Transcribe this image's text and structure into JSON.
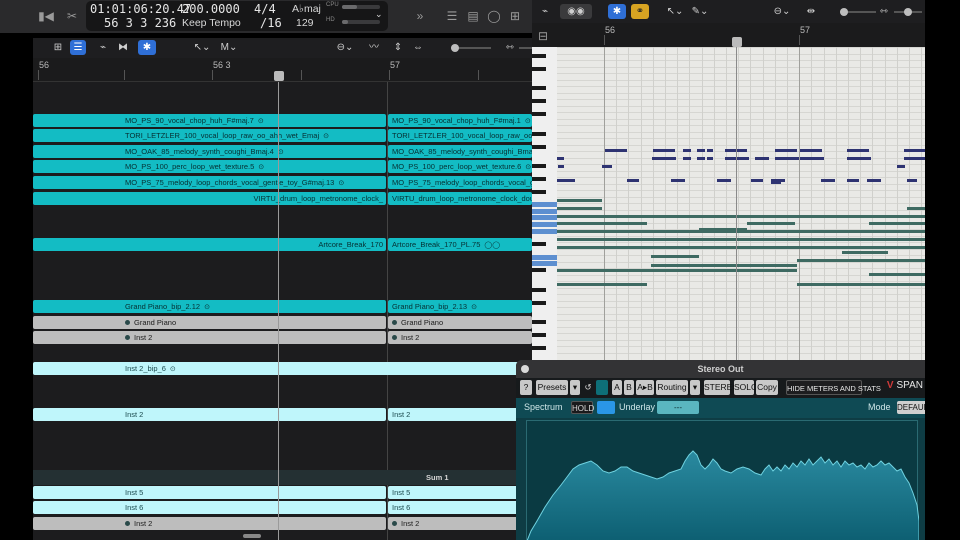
{
  "lcd": {
    "time": "01:01:06:20.47",
    "bars": "56  3  3  236",
    "tempo": "200.0000",
    "tempo_mode": "Keep Tempo",
    "signature": "4/4",
    "division": "/16",
    "key": "A♭maj",
    "midi_value": "129",
    "cpu_label": "CPU",
    "hd_label": "HD"
  },
  "ruler": {
    "bar56": "56",
    "bar56_3": "56 3",
    "bar57": "57"
  },
  "piano_ruler": {
    "bar56": "56",
    "bar57": "57"
  },
  "tracktoolbar": {
    "edit_menu": "M"
  },
  "regions": {
    "vocal_chop_a": "MO_PS_90_vocal_chop_huh_F#maj.7",
    "vocal_chop_b": "MO_PS_90_vocal_chop_huh_F#maj.1",
    "tori_a": "TORI_LETZLER_100_vocal_loop_raw_oo_ahh_wet_Emaj",
    "tori_b": "TORI_LETZLER_100_vocal_loop_raw_oo_ahh",
    "oak_a": "MO_OAK_85_melody_synth_coughi_Bmaj.4",
    "oak_b": "MO_OAK_85_melody_synth_coughi_Bmaj.5",
    "perc_a": "MO_PS_100_perc_loop_wet_texture.5",
    "perc_b": "MO_PS_100_perc_loop_wet_texture.6",
    "chords_a": "MO_PS_75_melody_loop_chords_vocal_gentle_toy_G#maj.13",
    "chords_b": "MO_PS_75_melody_loop_chords_vocal_gen",
    "drum_a": "VIRTU_drum_loop_metronome_clock_",
    "drum_b": "VIRTU_drum_loop_metronome_clock_doub",
    "break_a": "Artcore_Break_170",
    "break_b": "Artcore_Break_170_PL.75",
    "piano_bip_a": "Grand Piano_bip_2.12",
    "piano_bip_b": "Grand Piano_bip_2.13",
    "grand_piano": "Grand Piano",
    "inst2": "Inst 2",
    "inst2_bip": "Inst 2_bip_6",
    "sum1": "Sum 1",
    "inst5": "Inst 5",
    "inst6": "Inst 6"
  },
  "span": {
    "window_title": "Stereo Out",
    "presets": "Presets",
    "ab1": "A",
    "ab2": "B",
    "ab3": "A▸B",
    "routing": "Routing",
    "stereo": "STEREO",
    "solo": "SOLO",
    "copy": "Copy",
    "hide_meters": "HIDE METERS AND STATS",
    "logo": "SPAN",
    "help": "?",
    "spectrum": "Spectrum",
    "hold": "HOLD",
    "underlay": "Underlay",
    "underlay_value": "---",
    "mode_label": "Mode",
    "mode_value": "DEFAULT"
  },
  "colors": {
    "region_teal": "#13bcc4",
    "region_light": "#bff6fb",
    "note_navy": "#2e3372",
    "note_green": "#3e6a62",
    "span_bg": "#0e3c44"
  }
}
